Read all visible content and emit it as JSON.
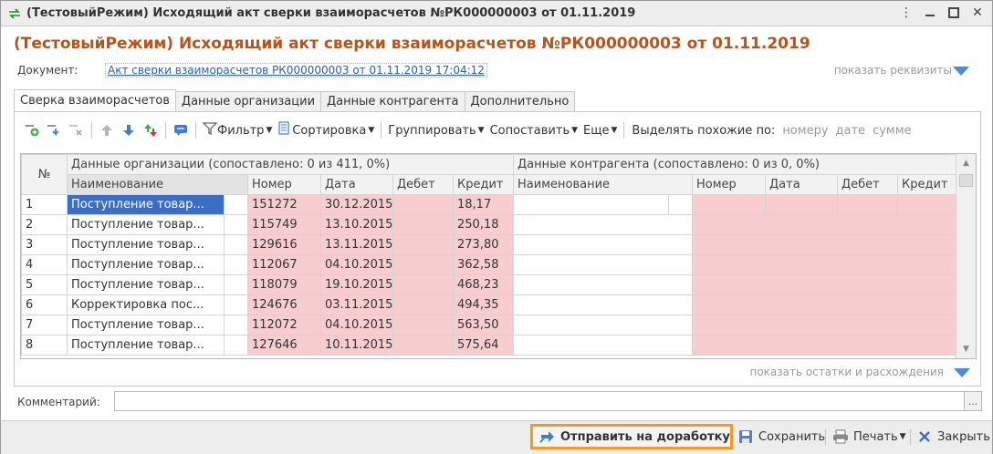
{
  "window": {
    "title": "(ТестовыйРежим) Исходящий акт сверки взаиморасчетов №РК000000003 от 01.11.2019"
  },
  "form": {
    "heading": "(ТестовыйРежим) Исходящий акт сверки взаиморасчетов №РК000000003 от 01.11.2019",
    "document_label": "Документ:",
    "document_link": "Акт сверки взаиморасчетов РК000000003 от 01.11.2019 17:04:12",
    "show_requisites": "показать реквизиты"
  },
  "tabs": [
    {
      "label": "Сверка взаиморасчетов",
      "active": true
    },
    {
      "label": "Данные организации",
      "active": false
    },
    {
      "label": "Данные контрагента",
      "active": false
    },
    {
      "label": "Дополнительно",
      "active": false
    }
  ],
  "toolbar": {
    "filter": "Фильтр",
    "sort": "Сортировка",
    "group": "Группировать",
    "match": "Сопоставить",
    "more": "Еще",
    "highlight_label": "Выделять похожие по:",
    "by_number": "номеру",
    "by_date": "дате",
    "by_sum": "сумме"
  },
  "grid": {
    "num_header": "№",
    "org_group": "Данные организации (сопоставлено: 0 из 411, 0%)",
    "cp_group": "Данные контрагента (сопоставлено: 0 из 0, 0%)",
    "columns": {
      "name": "Наименование",
      "number": "Номер",
      "date": "Дата",
      "debit": "Дебет",
      "credit": "Кредит"
    },
    "rows": [
      {
        "n": "1",
        "name": "Поступление товар...",
        "number": "151272",
        "date": "30.12.2015",
        "debit": "",
        "credit": "18,17"
      },
      {
        "n": "2",
        "name": "Поступление товар...",
        "number": "115749",
        "date": "13.10.2015",
        "debit": "",
        "credit": "250,18"
      },
      {
        "n": "3",
        "name": "Поступление товар...",
        "number": "129616",
        "date": "13.11.2015",
        "debit": "",
        "credit": "273,80"
      },
      {
        "n": "4",
        "name": "Поступление товар...",
        "number": "112067",
        "date": "04.10.2015",
        "debit": "",
        "credit": "362,58"
      },
      {
        "n": "5",
        "name": "Поступление товар...",
        "number": "118079",
        "date": "19.10.2015",
        "debit": "",
        "credit": "468,23"
      },
      {
        "n": "6",
        "name": "Корректировка пос...",
        "number": "124676",
        "date": "03.11.2015",
        "debit": "",
        "credit": "494,35"
      },
      {
        "n": "7",
        "name": "Поступление товар...",
        "number": "112072",
        "date": "04.10.2015",
        "debit": "",
        "credit": "563,50"
      },
      {
        "n": "8",
        "name": "Поступление товар...",
        "number": "127646",
        "date": "10.11.2015",
        "debit": "",
        "credit": "575,64"
      }
    ]
  },
  "show_rest": "показать остатки и расхождения",
  "comment": {
    "label": "Комментарий:",
    "value": "",
    "dots": "..."
  },
  "footer": {
    "send": "Отправить на доработку",
    "save": "Сохранить",
    "print": "Печать",
    "close": "Закрыть"
  },
  "colors": {
    "heading": "#b5541c",
    "link": "#2d5fa5",
    "selected_row": "#3d6dc2",
    "pink_cell": "#f7cdd0",
    "primary_outline": "#f29a21"
  },
  "icons": {
    "window": "exchange-arrows-icon",
    "filter": "funnel-icon",
    "sort": "sort-list-icon",
    "send": "send-arrow-icon",
    "save": "floppy-disk-icon",
    "print": "printer-icon",
    "close": "close-x-icon"
  }
}
